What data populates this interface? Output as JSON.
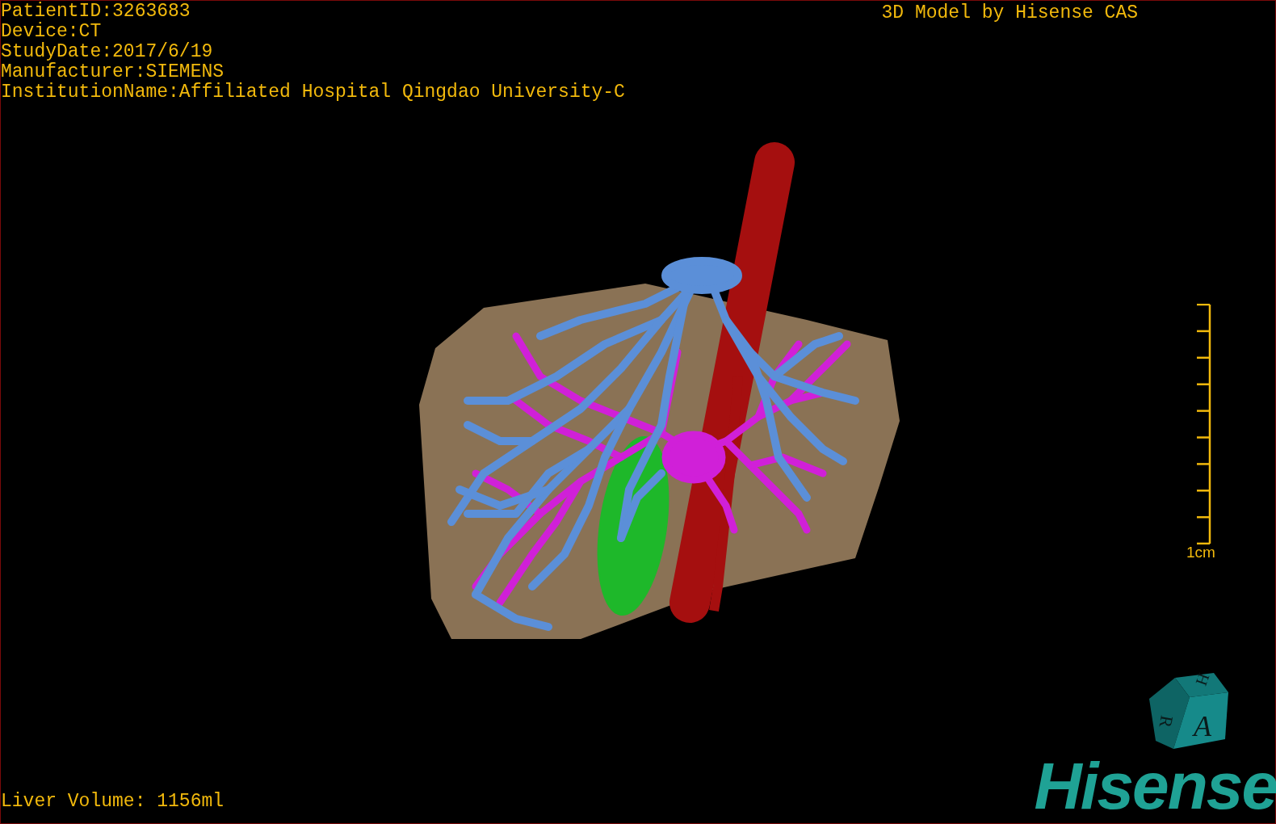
{
  "patient_info": [
    "PatientID:3263683",
    "Device:CT",
    "StudyDate:2017/6/19",
    "Manufacturer:SIEMENS",
    "InstitutionName:Affiliated Hospital Qingdao University-C"
  ],
  "title": "3D Model by Hisense CAS",
  "scale": {
    "label": "1cm"
  },
  "liver_volume": "Liver Volume: 1156ml",
  "orientation_cube": {
    "top": "H",
    "left": "R",
    "front": "A"
  },
  "logo": "Hisense"
}
